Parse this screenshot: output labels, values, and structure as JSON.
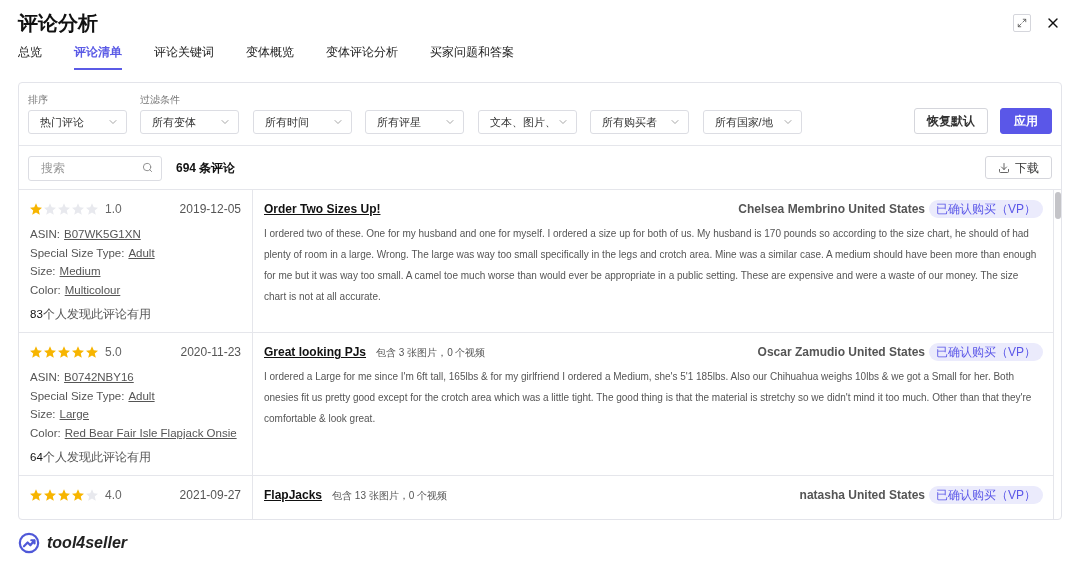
{
  "window": {
    "title": "评论分析"
  },
  "tabs": [
    {
      "label": "总览",
      "selected": false
    },
    {
      "label": "评论清单",
      "selected": true
    },
    {
      "label": "评论关键词",
      "selected": false
    },
    {
      "label": "变体概览",
      "selected": false
    },
    {
      "label": "变体评论分析",
      "selected": false
    },
    {
      "label": "买家问题和答案",
      "selected": false
    }
  ],
  "sort": {
    "label": "排序",
    "value": "热门评论"
  },
  "filter": {
    "label": "过滤条件",
    "dropdowns": [
      "所有变体",
      "所有时间",
      "所有评星",
      "文本、图片、",
      "所有购买者",
      "所有国家/地"
    ]
  },
  "actions": [
    {
      "label": "恢复默认",
      "kind": "secondary"
    },
    {
      "label": "应用",
      "kind": "primary"
    }
  ],
  "search": {
    "placeholder": "搜索"
  },
  "review_count": "694 条评论",
  "download_button": "下载",
  "reviews": [
    {
      "stars": 1,
      "rating": "1.0",
      "date": "2019-12-05",
      "attributes": [
        {
          "label": "ASIN:",
          "value": "B07WK5G1XN"
        },
        {
          "label": "Special Size Type:",
          "value": "Adult"
        },
        {
          "label": "Size:",
          "value": "Medium"
        },
        {
          "label": "Color:",
          "value": "Multicolour"
        }
      ],
      "helpful": {
        "count": "83",
        "text": "个人发现此评论有用"
      },
      "title": "Order Two Sizes Up!",
      "reviewer": "Chelsea Membrino United States",
      "badge": "已确认购买（VP）",
      "body": "I ordered two of these. One for my husband and one for myself. I ordered a size up for both of us. My husband is 170 pounds so according to the size chart, he should of had plenty of room in a large. Wrong. The large was way too small specifically in the legs and crotch area. Mine was a similar case. A medium should have been more than enough for me but it was way too small. A camel toe much worse than would ever be appropriate in a public setting. These are expensive and were a waste of our money. The size chart is not at all accurate."
    },
    {
      "stars": 5,
      "rating": "5.0",
      "date": "2020-11-23",
      "attributes": [
        {
          "label": "ASIN:",
          "value": "B0742NBY16"
        },
        {
          "label": "Special Size Type:",
          "value": "Adult"
        },
        {
          "label": "Size:",
          "value": "Large"
        },
        {
          "label": "Color:",
          "value": "Red Bear Fair Isle Flapjack Onsie"
        }
      ],
      "helpful": {
        "count": "64",
        "text": "个人发现此评论有用"
      },
      "title": "Great looking PJs",
      "media": "包含 3 张图片，0 个视频",
      "reviewer": "Oscar Zamudio United States",
      "badge": "已确认购买（VP）",
      "body": "I ordered a Large for me since I'm 6ft tall, 165lbs & for my girlfriend I ordered a Medium, she's 5'1 185lbs. Also our Chihuahua weighs 10lbs & we got a Small for her. Both onesies fit us pretty good except for the crotch area which was a little tight. The good thing is that the material is stretchy so we didn't mind it too much. Other than that they're comfortable & look great."
    },
    {
      "stars": 4,
      "rating": "4.0",
      "date": "2021-09-27",
      "title": "FlapJacks",
      "media": "包含 13 张图片，0 个视频",
      "reviewer": "natasha United States",
      "badge": "已确认购买（VP）"
    }
  ],
  "footer": {
    "logo_text": "tool4seller"
  }
}
